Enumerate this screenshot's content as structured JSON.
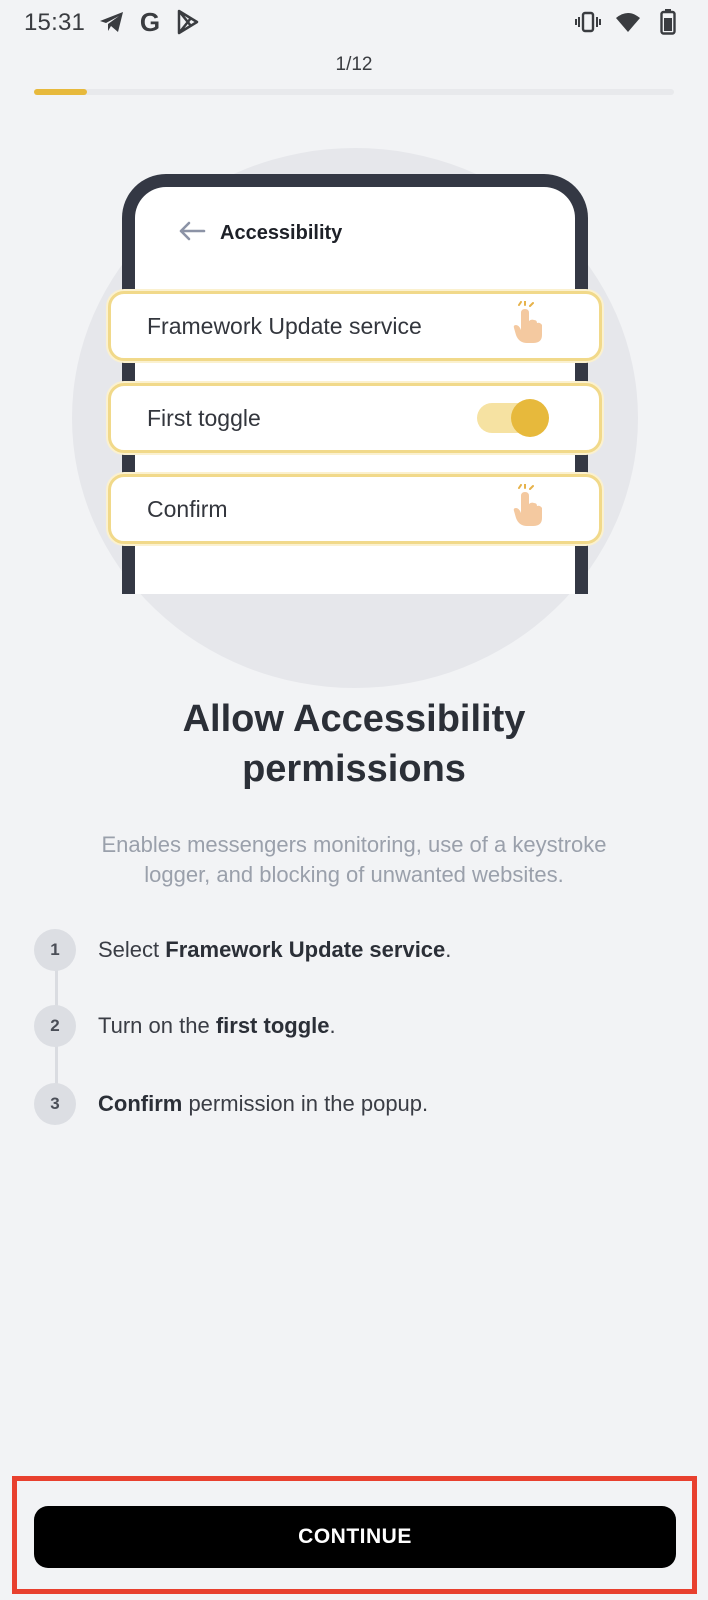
{
  "status_bar": {
    "time": "15:31",
    "left_icons": [
      "telegram-icon",
      "google-icon",
      "play-store-icon"
    ],
    "google_letter": "G",
    "right_icons": [
      "vibrate-icon",
      "wifi-icon",
      "battery-icon"
    ]
  },
  "progress": {
    "label": "1/12",
    "current": 1,
    "total": 12,
    "color": "#e7b93c"
  },
  "illustration": {
    "header_title": "Accessibility",
    "back_icon": "arrow-left-icon",
    "cards": [
      {
        "label": "Framework Update service",
        "accessory": "tap-hand-icon"
      },
      {
        "label": "First toggle",
        "accessory": "toggle-on"
      },
      {
        "label": "Confirm",
        "accessory": "tap-hand-icon"
      }
    ]
  },
  "heading": {
    "line1": "Allow Accessibility",
    "line2": "permissions"
  },
  "subtitle": {
    "line1": "Enables messengers monitoring, use of a keystroke",
    "line2": "logger, and blocking of unwanted websites."
  },
  "steps": [
    {
      "num": "1",
      "pre": "Select ",
      "bold": "Framework Update service",
      "post": "."
    },
    {
      "num": "2",
      "pre": "Turn on the ",
      "bold": "first toggle",
      "post": "."
    },
    {
      "num": "3",
      "pre": "",
      "bold": "Confirm",
      "post": " permission in the popup."
    }
  ],
  "continue_button": {
    "label": "CONTINUE"
  },
  "colors": {
    "accent": "#e7b93c",
    "highlight_outline": "#e8402e",
    "background": "#f2f3f5"
  }
}
